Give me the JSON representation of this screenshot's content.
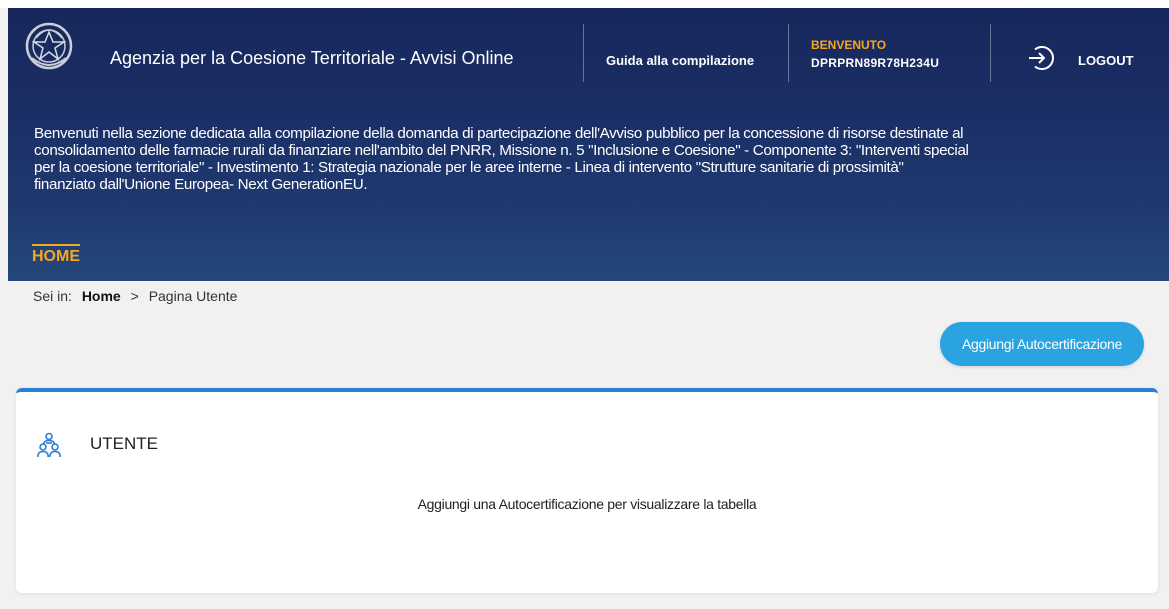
{
  "header": {
    "app_title": "Agenzia per la Coesione Territoriale - Avvisi Online",
    "guide_link": "Guida alla compilazione",
    "welcome_label": "BENVENUTO",
    "user_code": "DPRPRN89R78H234U",
    "logout_label": "LOGOUT",
    "intro_text": "Benvenuti nella sezione dedicata alla compilazione della domanda di partecipazione dell'Avviso pubblico per la concessione di risorse destinate al\nconsolidamento delle farmacie rurali da finanziare nell'ambito del PNRR, Missione n. 5 \"Inclusione e Coesione\" - Componente 3: \"Interventi special\nper la coesione territoriale\" - Investimento 1: Strategia nazionale per le aree interne - Linea di intervento \"Strutture sanitarie di prossimità\"\nfinanziato dall'Unione Europea- Next GenerationEU.",
    "nav_home": "HOME"
  },
  "breadcrumb": {
    "prefix": "Sei in:",
    "home": "Home",
    "separator": ">",
    "current": "Pagina Utente"
  },
  "actions": {
    "add_self_certification": "Aggiungi Autocertificazione"
  },
  "card": {
    "title": "UTENTE",
    "empty_message": "Aggiungi una Autocertificazione per visualizzare la tabella"
  },
  "icons": {
    "emblem": "italian-republic-emblem-icon",
    "logout": "logout-icon",
    "users": "users-group-icon"
  },
  "colors": {
    "header_bg": "#1b2f66",
    "accent_orange": "#f5a623",
    "primary_blue": "#2aa4e0",
    "card_border": "#2d7fd6",
    "page_bg": "#f1f1f1"
  }
}
